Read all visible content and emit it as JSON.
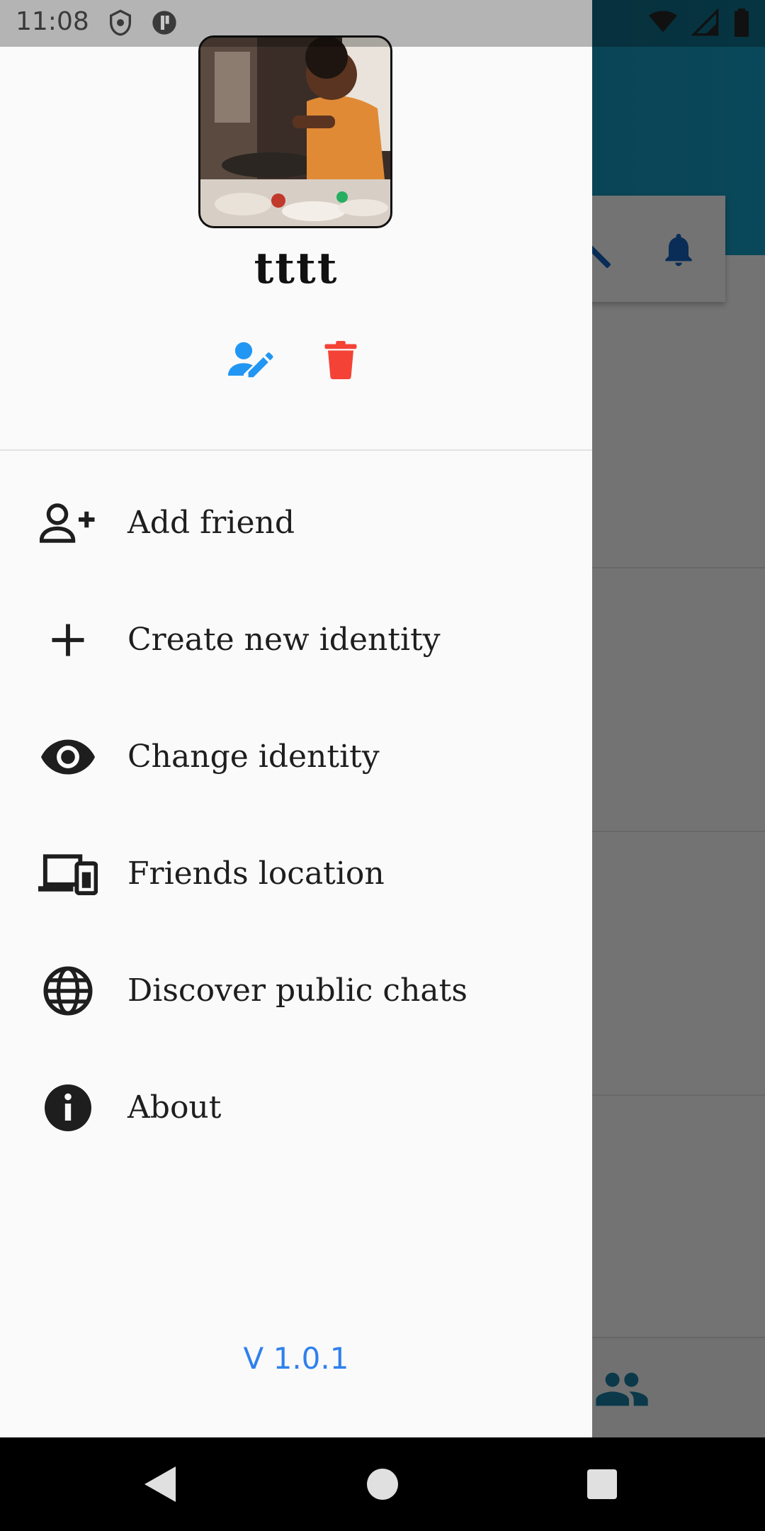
{
  "status_bar": {
    "time": "11:08"
  },
  "profile": {
    "name": "tttt"
  },
  "menu": {
    "items": [
      {
        "label": "Add friend",
        "icon": "add-friend-icon"
      },
      {
        "label": "Create new identity",
        "icon": "plus-icon"
      },
      {
        "label": "Change identity",
        "icon": "eye-icon"
      },
      {
        "label": "Friends location",
        "icon": "devices-icon"
      },
      {
        "label": "Discover public chats",
        "icon": "globe-icon"
      },
      {
        "label": "About",
        "icon": "info-icon"
      }
    ]
  },
  "footer": {
    "version": "V 1.0.1"
  },
  "colors": {
    "accent": "#2196f3",
    "delete": "#f44336",
    "version": "#2f80ed",
    "header": "#1a8fb5"
  }
}
